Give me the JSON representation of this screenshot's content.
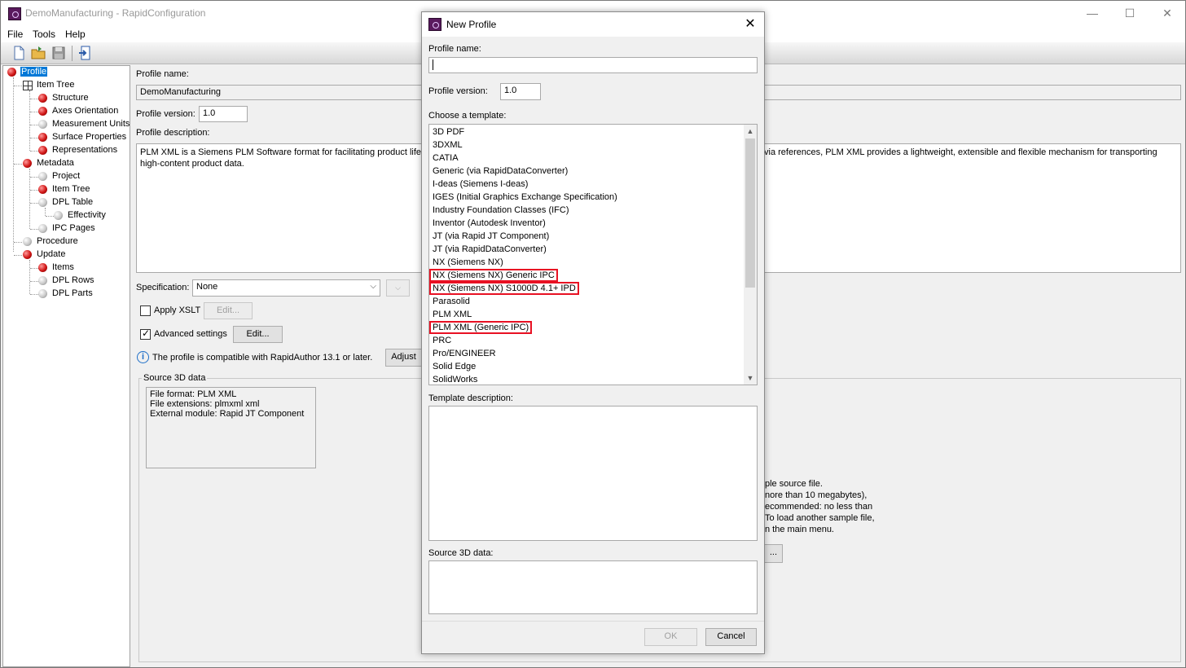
{
  "window": {
    "title": "DemoManufacturing - RapidConfiguration",
    "controls": {
      "minimize": "—",
      "maximize": "☐",
      "close": "✕"
    }
  },
  "menu": {
    "file": "File",
    "tools": "Tools",
    "help": "Help"
  },
  "toolbar": {
    "icons": [
      "new-file-icon",
      "open-folder-icon",
      "save-icon",
      "import-icon"
    ]
  },
  "tree": {
    "profile": "Profile",
    "item_tree": "Item Tree",
    "structure": "Structure",
    "axes_orientation": "Axes Orientation",
    "measurement_units": "Measurement Units",
    "surface_properties": "Surface Properties",
    "representations": "Representations",
    "metadata": "Metadata",
    "project": "Project",
    "meta_item_tree": "Item Tree",
    "dpl_table": "DPL Table",
    "effectivity": "Effectivity",
    "ipc_pages": "IPC Pages",
    "procedure": "Procedure",
    "update": "Update",
    "items": "Items",
    "dpl_rows": "DPL Rows",
    "dpl_parts": "DPL Parts"
  },
  "main": {
    "profile_name_label": "Profile name:",
    "profile_name_value": "DemoManufacturing",
    "profile_version_label": "Profile version:",
    "profile_version_value": "1.0",
    "profile_description_label": "Profile description:",
    "description_left_line1": "PLM XML is a Siemens PLM Software format for facilitating product lifecyc",
    "description_left_line2": "high-content product data.",
    "description_right_line1": "via references, PLM XML provides a lightweight, extensible and flexible mechanism for transporting",
    "specification_label": "Specification:",
    "specification_value": "None",
    "apply_xslt_label": "Apply XSLT",
    "edit_disabled_label": "Edit...",
    "advanced_settings_label": "Advanced settings",
    "edit_label": "Edit...",
    "compat_text": "The profile is compatible with RapidAuthor 13.1 or later.",
    "adjust_label": "Adjust",
    "source_group_title": "Source 3D data",
    "source_line1": "File format: PLM XML",
    "source_line2": "File extensions: plmxml xml",
    "source_line3": "External module: Rapid JT Component",
    "sample_text_line1": "ple source file.",
    "sample_text_line2": "nore than 10 megabytes),",
    "sample_text_line3": "ecommended: no less than",
    "sample_text_line4": "To load another sample file,",
    "sample_text_line5": "n the main menu.",
    "sample_button_label": "..."
  },
  "dialog": {
    "title": "New Profile",
    "close": "✕",
    "profile_name_label": "Profile name:",
    "profile_name_value": "",
    "profile_version_label": "Profile version:",
    "profile_version_value": "1.0",
    "choose_template_label": "Choose a template:",
    "templates": [
      "3D PDF",
      "3DXML",
      "CATIA",
      "Generic (via RapidDataConverter)",
      "I-deas (Siemens I-deas)",
      "IGES (Initial Graphics Exchange Specification)",
      "Industry Foundation Classes (IFC)",
      "Inventor (Autodesk Inventor)",
      "JT (via Rapid JT Component)",
      "JT (via RapidDataConverter)",
      "NX (Siemens NX)",
      "NX (Siemens NX) Generic IPC",
      "NX (Siemens NX) S1000D 4.1+ IPD",
      "Parasolid",
      "PLM XML",
      "PLM XML (Generic IPC)",
      "PRC",
      "Pro/ENGINEER",
      "Solid Edge",
      "SolidWorks"
    ],
    "highlight_color": "#e81123",
    "template_description_label": "Template description:",
    "source_3d_label": "Source 3D data:",
    "ok_label": "OK",
    "cancel_label": "Cancel"
  }
}
